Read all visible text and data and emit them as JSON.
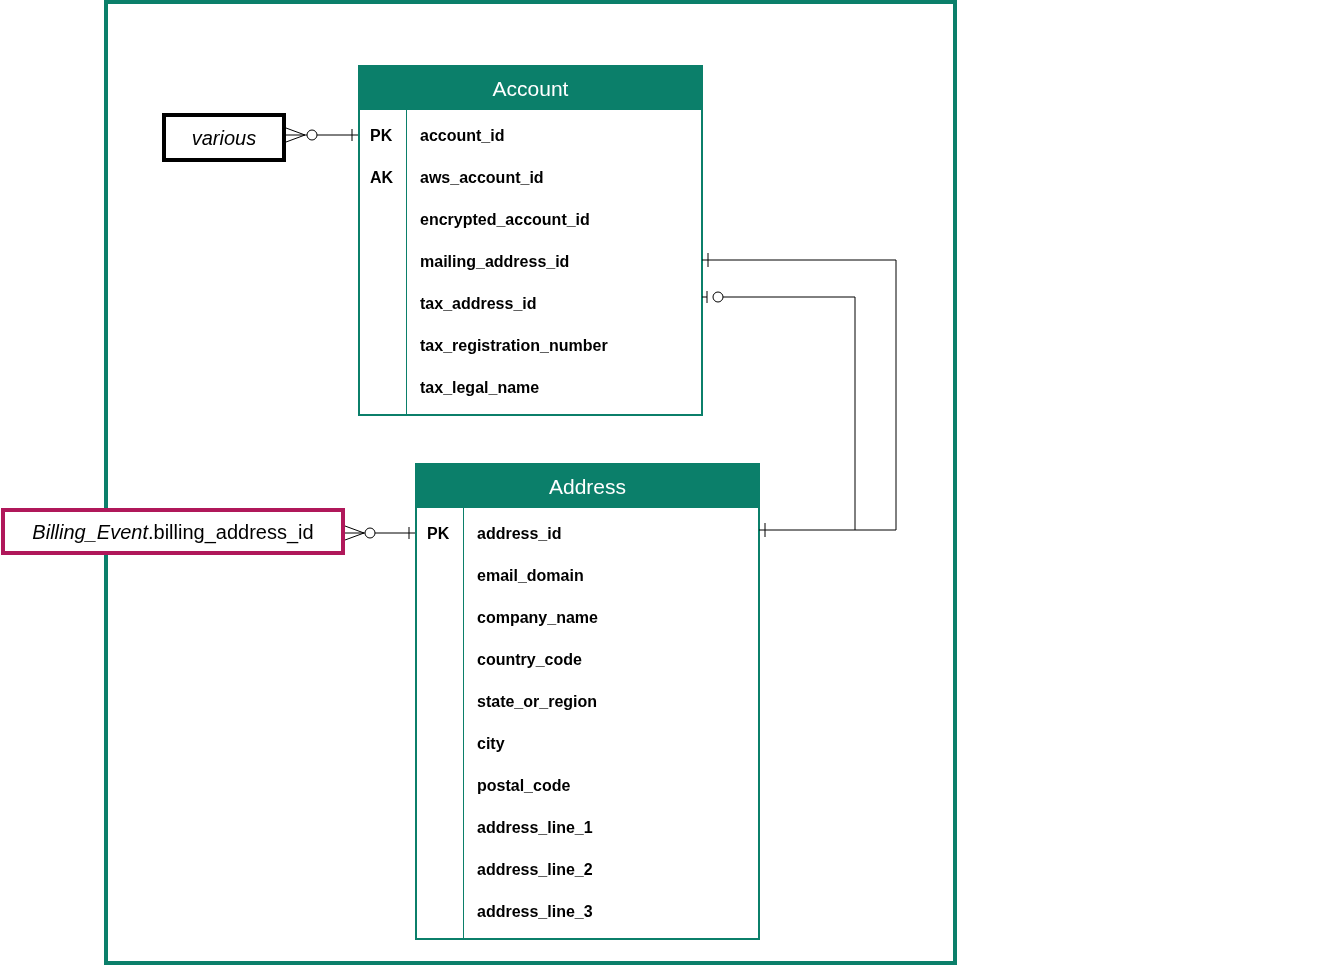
{
  "entities": [
    {
      "title": "Account",
      "fields": [
        {
          "key": "PK",
          "name": "account_id"
        },
        {
          "key": "AK",
          "name": "aws_account_id"
        },
        {
          "name": "encrypted_account_id"
        },
        {
          "name": "mailing_address_id"
        },
        {
          "name": "tax_address_id"
        },
        {
          "name": "tax_registration_number"
        },
        {
          "name": "tax_legal_name"
        }
      ]
    },
    {
      "title": "Address",
      "fields": [
        {
          "key": "PK",
          "name": "address_id"
        },
        {
          "name": "email_domain"
        },
        {
          "name": "company_name"
        },
        {
          "name": "country_code"
        },
        {
          "name": "state_or_region"
        },
        {
          "name": "city"
        },
        {
          "name": "postal_code"
        },
        {
          "name": "address_line_1"
        },
        {
          "name": "address_line_2"
        },
        {
          "name": "address_line_3"
        }
      ]
    }
  ],
  "external_refs": [
    {
      "label": "various",
      "color": "#000000"
    },
    {
      "label": "*Billing_Event*.billing_address_id",
      "color": "#b0185a"
    }
  ]
}
